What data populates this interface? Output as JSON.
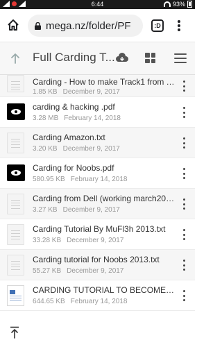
{
  "status_bar": {
    "time": "6:44",
    "battery": "93%"
  },
  "browser": {
    "url": "mega.nz/folder/PF",
    "tab_count": ":D"
  },
  "header": {
    "folder_title": "Full Carding T..."
  },
  "files": [
    {
      "name": "Carding - How to make Track1 from T...",
      "size": "1.85 KB",
      "date": "December 9, 2017",
      "icon": "text-file-icon",
      "kind": "txt"
    },
    {
      "name": "carding & hacking .pdf",
      "size": "3.28 MB",
      "date": "February 14, 2018",
      "icon": "pdf-file-icon",
      "kind": "pdf"
    },
    {
      "name": "Carding Amazon.txt",
      "size": "3.20 KB",
      "date": "December 9, 2017",
      "icon": "text-file-icon",
      "kind": "txt"
    },
    {
      "name": "Carding for Noobs.pdf",
      "size": "580.95 KB",
      "date": "February 14, 2018",
      "icon": "pdf-file-icon",
      "kind": "pdf"
    },
    {
      "name": "Carding from Dell (working march201...",
      "size": "3.27 KB",
      "date": "December 9, 2017",
      "icon": "text-file-icon",
      "kind": "txt"
    },
    {
      "name": "Carding Tutorial By MuFl3h 2013.txt",
      "size": "33.28 KB",
      "date": "December 9, 2017",
      "icon": "text-file-icon",
      "kind": "txt"
    },
    {
      "name": "Carding tutorial for Noobs 2013.txt",
      "size": "55.27 KB",
      "date": "December 9, 2017",
      "icon": "text-file-icon",
      "kind": "txt"
    },
    {
      "name": "CARDING TUTORIAL TO BECOME A...",
      "size": "644.65 KB",
      "date": "February 14, 2018",
      "icon": "document-file-icon",
      "kind": "doc"
    }
  ]
}
